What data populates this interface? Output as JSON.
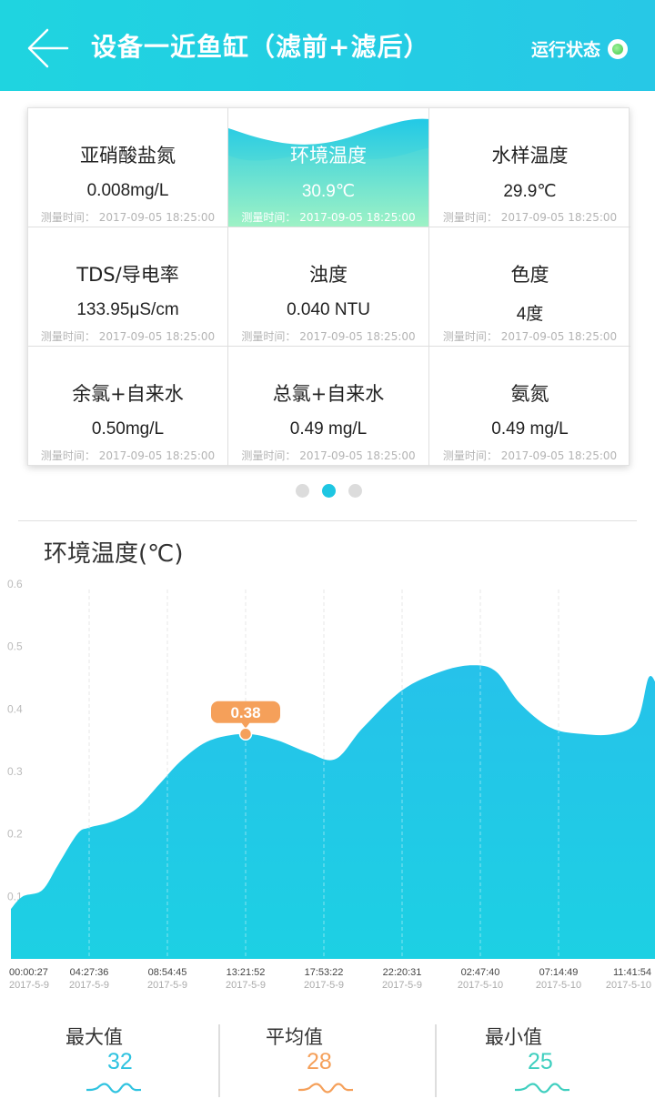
{
  "header": {
    "title": "设备一近鱼缸（滤前+滤后）",
    "status_label": "运行状态"
  },
  "cards": [
    {
      "name": "亚硝酸盐氮",
      "value": "0.008mg/L",
      "time_label": "测量时间：",
      "time": "2017-09-05 18:25:00",
      "active": false
    },
    {
      "name": "环境温度",
      "value": "30.9℃",
      "time_label": "测量时间：",
      "time": "2017-09-05 18:25:00",
      "active": true
    },
    {
      "name": "水样温度",
      "value": "29.9℃",
      "time_label": "测量时间：",
      "time": "2017-09-05 18:25:00",
      "active": false
    },
    {
      "name": "TDS/导电率",
      "value": "133.95μS/cm",
      "time_label": "测量时间：",
      "time": "2017-09-05 18:25:00",
      "active": false
    },
    {
      "name": "浊度",
      "value": "0.040 NTU",
      "time_label": "测量时间：",
      "time": "2017-09-05 18:25:00",
      "active": false
    },
    {
      "name": "色度",
      "value": "4度",
      "time_label": "测量时间：",
      "time": "2017-09-05 18:25:00",
      "active": false
    },
    {
      "name": "余氯+自来水",
      "value": "0.50mg/L",
      "time_label": "测量时间：",
      "time": "2017-09-05 18:25:00",
      "active": false
    },
    {
      "name": "总氯+自来水",
      "value": "0.49 mg/L",
      "time_label": "测量时间：",
      "time": "2017-09-05 18:25:00",
      "active": false
    },
    {
      "name": "氨氮",
      "value": "0.49 mg/L",
      "time_label": "测量时间：",
      "time": "2017-09-05 18:25:00",
      "active": false
    }
  ],
  "pager": {
    "count": 3,
    "active_index": 1
  },
  "chart_title": "环境温度(℃)",
  "chart_data": {
    "type": "area",
    "title": "环境温度(℃)",
    "ylim": [
      0,
      0.6
    ],
    "yticks": [
      "0.1",
      "0.2",
      "0.3",
      "0.4",
      "0.5",
      "0.6"
    ],
    "x_labels": [
      {
        "time": "00:00:27",
        "date": "2017-5-9"
      },
      {
        "time": "04:27:36",
        "date": "2017-5-9"
      },
      {
        "time": "08:54:45",
        "date": "2017-5-9"
      },
      {
        "time": "13:21:52",
        "date": "2017-5-9"
      },
      {
        "time": "17:53:22",
        "date": "2017-5-9"
      },
      {
        "time": "22:20:31",
        "date": "2017-5-9"
      },
      {
        "time": "02:47:40",
        "date": "2017-5-10"
      },
      {
        "time": "07:14:49",
        "date": "2017-5-10"
      },
      {
        "time": "11:41:54",
        "date": "2017-5-10"
      }
    ],
    "points": [
      [
        0.0,
        0.08
      ],
      [
        0.15,
        0.1
      ],
      [
        0.4,
        0.11
      ],
      [
        0.6,
        0.15
      ],
      [
        0.85,
        0.2
      ],
      [
        1.0,
        0.21
      ],
      [
        1.3,
        0.22
      ],
      [
        1.6,
        0.24
      ],
      [
        1.9,
        0.28
      ],
      [
        2.2,
        0.32
      ],
      [
        2.55,
        0.35
      ],
      [
        3.0,
        0.36
      ],
      [
        3.4,
        0.35
      ],
      [
        3.8,
        0.33
      ],
      [
        4.15,
        0.32
      ],
      [
        4.5,
        0.37
      ],
      [
        5.0,
        0.43
      ],
      [
        5.5,
        0.46
      ],
      [
        5.9,
        0.47
      ],
      [
        6.2,
        0.46
      ],
      [
        6.5,
        0.41
      ],
      [
        6.9,
        0.37
      ],
      [
        7.3,
        0.36
      ],
      [
        7.7,
        0.36
      ],
      [
        8.0,
        0.38
      ],
      [
        8.15,
        0.45
      ],
      [
        8.25,
        0.44
      ]
    ],
    "marker": {
      "x": 3.0,
      "y": 0.36,
      "label": "0.38"
    },
    "fill_color": "#1dd0e3",
    "marker_color": "#f5a05a"
  },
  "stats": [
    {
      "label": "最大值",
      "value": "32",
      "color": "#2fc3e0"
    },
    {
      "label": "平均值",
      "value": "28",
      "color": "#f5a05a"
    },
    {
      "label": "最小值",
      "value": "25",
      "color": "#3fcfbf"
    }
  ]
}
